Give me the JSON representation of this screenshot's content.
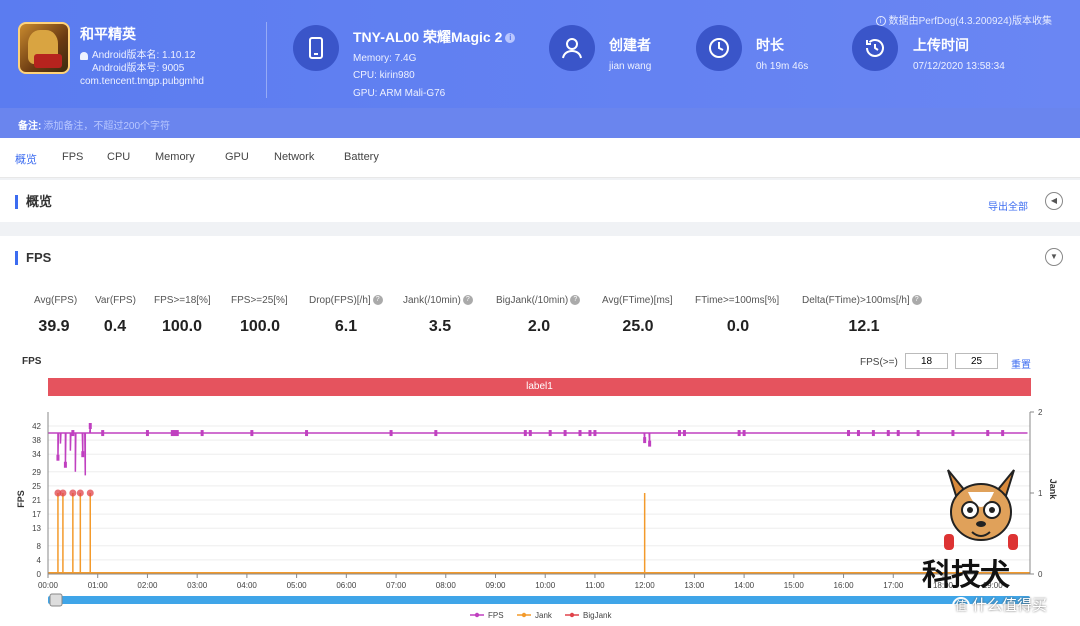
{
  "header": {
    "data_note": "数据由PerfDog(4.3.200924)版本收集",
    "app": {
      "name": "和平精英",
      "version_name": "Android版本名: 1.10.12",
      "version_code": "Android版本号: 9005",
      "package": "com.tencent.tmgp.pubgmhd"
    },
    "device": {
      "model": "TNY-AL00 荣耀Magic 2",
      "memory": "Memory: 7.4G",
      "cpu": "CPU: kirin980",
      "gpu": "GPU: ARM Mali-G76"
    },
    "creator": {
      "title": "创建者",
      "value": "jian wang"
    },
    "duration": {
      "title": "时长",
      "value": "0h 19m 46s"
    },
    "upload": {
      "title": "上传时间",
      "value": "07/12/2020 13:58:34"
    },
    "note": {
      "label": "备注:",
      "placeholder": "添加备注，不超过200个字符"
    }
  },
  "tabs": [
    "概览",
    "FPS",
    "CPU",
    "Memory",
    "GPU",
    "Network",
    "Battery"
  ],
  "overview": {
    "title": "概览",
    "export": "导出全部"
  },
  "fps_panel": {
    "title": "FPS",
    "stats": [
      {
        "label": "Avg(FPS)",
        "value": "39.9",
        "help": false
      },
      {
        "label": "Var(FPS)",
        "value": "0.4",
        "help": false
      },
      {
        "label": "FPS>=18[%]",
        "value": "100.0",
        "help": false
      },
      {
        "label": "FPS>=25[%]",
        "value": "100.0",
        "help": false
      },
      {
        "label": "Drop(FPS)[/h]",
        "value": "6.1",
        "help": true
      },
      {
        "label": "Jank(/10min)",
        "value": "3.5",
        "help": true
      },
      {
        "label": "BigJank(/10min)",
        "value": "2.0",
        "help": true
      },
      {
        "label": "Avg(FTime)[ms]",
        "value": "25.0",
        "help": false
      },
      {
        "label": "FTime>=100ms[%]",
        "value": "0.0",
        "help": false
      },
      {
        "label": "Delta(FTime)>100ms[/h]",
        "value": "12.1",
        "help": true
      }
    ],
    "chart_label": "FPS",
    "fps_ge_label": "FPS(>=)",
    "fps_ge_values": [
      "18",
      "25"
    ],
    "reset": "重置",
    "band_label": "label1"
  },
  "chart_data": {
    "type": "line",
    "ylabel": "FPS",
    "y2label": "Jank",
    "y_ticks": [
      0,
      4,
      8,
      13,
      17,
      21,
      25,
      29,
      34,
      38,
      42
    ],
    "y2_ticks": [
      0,
      1,
      2
    ],
    "x_ticks": [
      "00:00",
      "01:00",
      "02:00",
      "03:00",
      "04:00",
      "05:00",
      "06:00",
      "07:00",
      "08:00",
      "09:00",
      "10:00",
      "11:00",
      "12:00",
      "13:00",
      "14:00",
      "15:00",
      "16:00",
      "17:00",
      "18:00",
      "19:00"
    ],
    "series": [
      {
        "name": "FPS",
        "color": "#c040c0",
        "baseline": 40,
        "dips": [
          [
            0.2,
            33
          ],
          [
            0.25,
            37
          ],
          [
            0.35,
            31
          ],
          [
            0.45,
            35
          ],
          [
            0.55,
            29
          ],
          [
            0.7,
            34
          ],
          [
            0.75,
            28
          ],
          [
            0.85,
            42
          ],
          [
            12.0,
            38
          ],
          [
            12.1,
            37
          ]
        ]
      },
      {
        "name": "Jank",
        "color": "#f39a2b",
        "spikes": [
          0.2,
          0.3,
          0.5,
          0.65,
          0.85,
          12.0
        ]
      },
      {
        "name": "BigJank",
        "color": "#e0434a",
        "spikes": [
          0.2,
          0.3,
          0.5,
          0.65,
          0.85
        ]
      }
    ]
  },
  "watermark": {
    "brand": "科技犬",
    "site": "什么值得买"
  },
  "colors": {
    "accent": "#3c6cf0",
    "header": "#5b7cf0",
    "fps": "#c040c0",
    "jank": "#f39a2b",
    "bigjank": "#e0434a",
    "band": "#e5535e"
  }
}
